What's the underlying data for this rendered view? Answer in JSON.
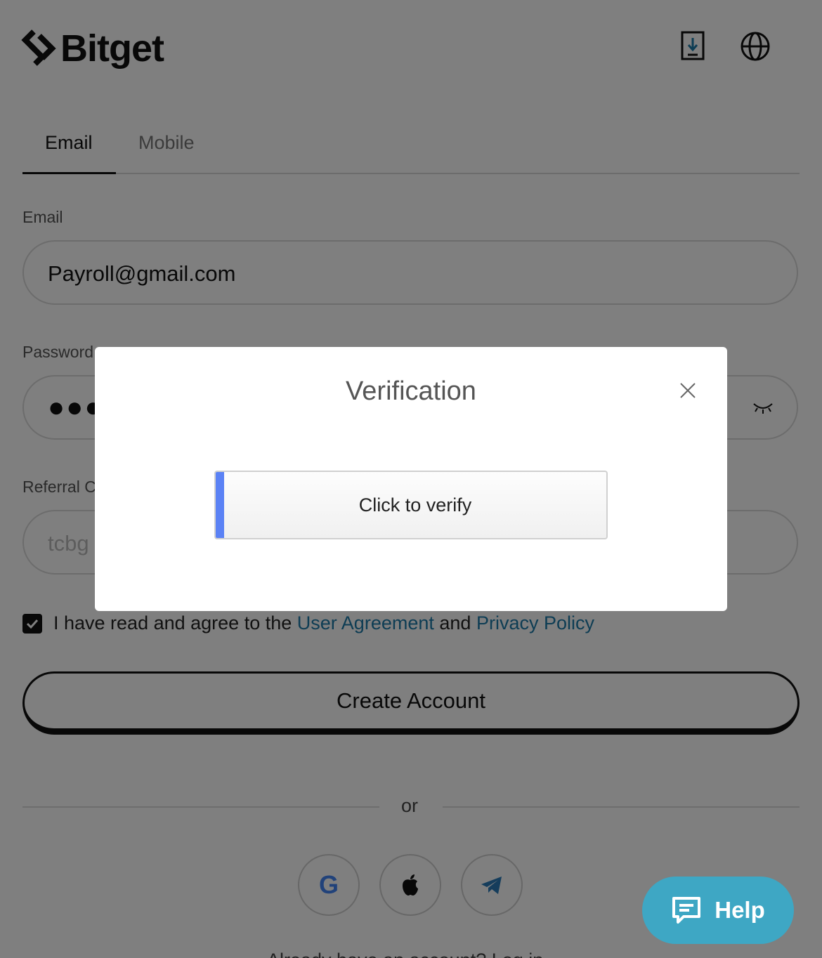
{
  "header": {
    "brand": "Bitget",
    "download_icon": "download-icon",
    "language_icon": "globe-icon"
  },
  "tabs": [
    {
      "label": "Email",
      "active": true
    },
    {
      "label": "Mobile",
      "active": false
    }
  ],
  "form": {
    "email": {
      "label": "Email",
      "value": "Payroll@gmail.com"
    },
    "password": {
      "label": "Password",
      "masked_value": "●●●●"
    },
    "referral": {
      "label": "Referral Code",
      "placeholder": "tcbg"
    }
  },
  "agreement": {
    "checked": true,
    "prefix": "I have read and agree to the",
    "user_agreement": "User Agreement",
    "joiner": "and",
    "privacy_policy": "Privacy Policy"
  },
  "create_account_label": "Create Account",
  "divider_label": "or",
  "social_logins": [
    "google-icon",
    "apple-icon",
    "telegram-icon"
  ],
  "bottom_text": "Already have an account? Log in",
  "help_label": "Help",
  "modal": {
    "title": "Verification",
    "verify_label": "Click to verify"
  },
  "colors": {
    "accent_link": "#1d7aa8",
    "help_bg": "#3ea7c4",
    "verify_accent": "#5b82f5",
    "overlay": "rgba(0,0,0,0.5)"
  }
}
